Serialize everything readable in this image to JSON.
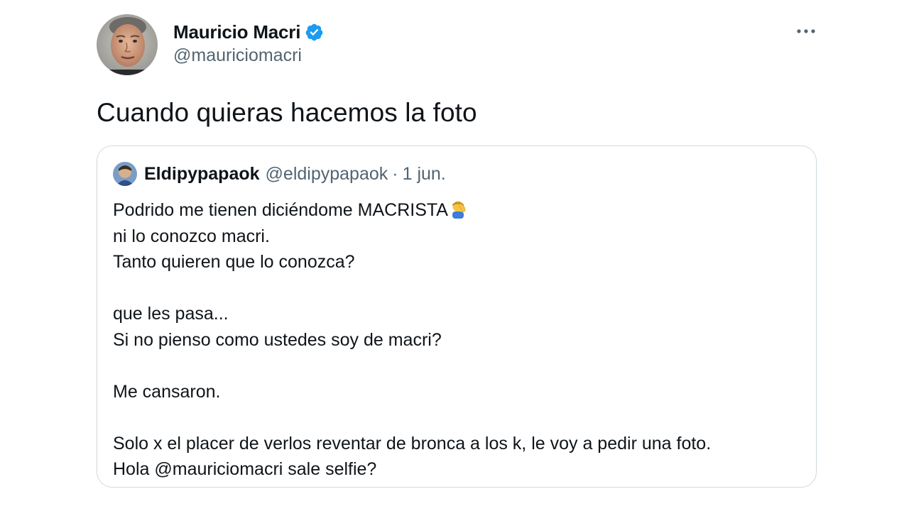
{
  "author": {
    "name": "Mauricio Macri",
    "handle": "@mauriciomacri",
    "verified": true,
    "verified_color": "#1d9bf0"
  },
  "header": {
    "more_icon": "more-horizontal-icon"
  },
  "tweet": {
    "text": "Cuando quieras hacemos la foto"
  },
  "quote": {
    "name": "Eldipypapaok",
    "handle": "@eldipypapaok",
    "separator": "·",
    "date": "1 jun.",
    "lines": [
      "Podrido me tienen diciéndome MACRISTA",
      "ni lo conozco macri.",
      "Tanto quieren que lo conozca?",
      "",
      "que les pasa...",
      "Si no pienso como ustedes soy de macri?",
      "",
      "Me cansaron.",
      "",
      "Solo x el placer de verlos reventar de bronca a los k, le voy a pedir una foto.",
      "Hola @mauriciomacri sale selfie?"
    ],
    "emoji_after_line_0": "man-facepalming-emoji"
  },
  "colors": {
    "text_primary": "#0f1419",
    "text_secondary": "#536471",
    "border": "#cfd9de"
  }
}
